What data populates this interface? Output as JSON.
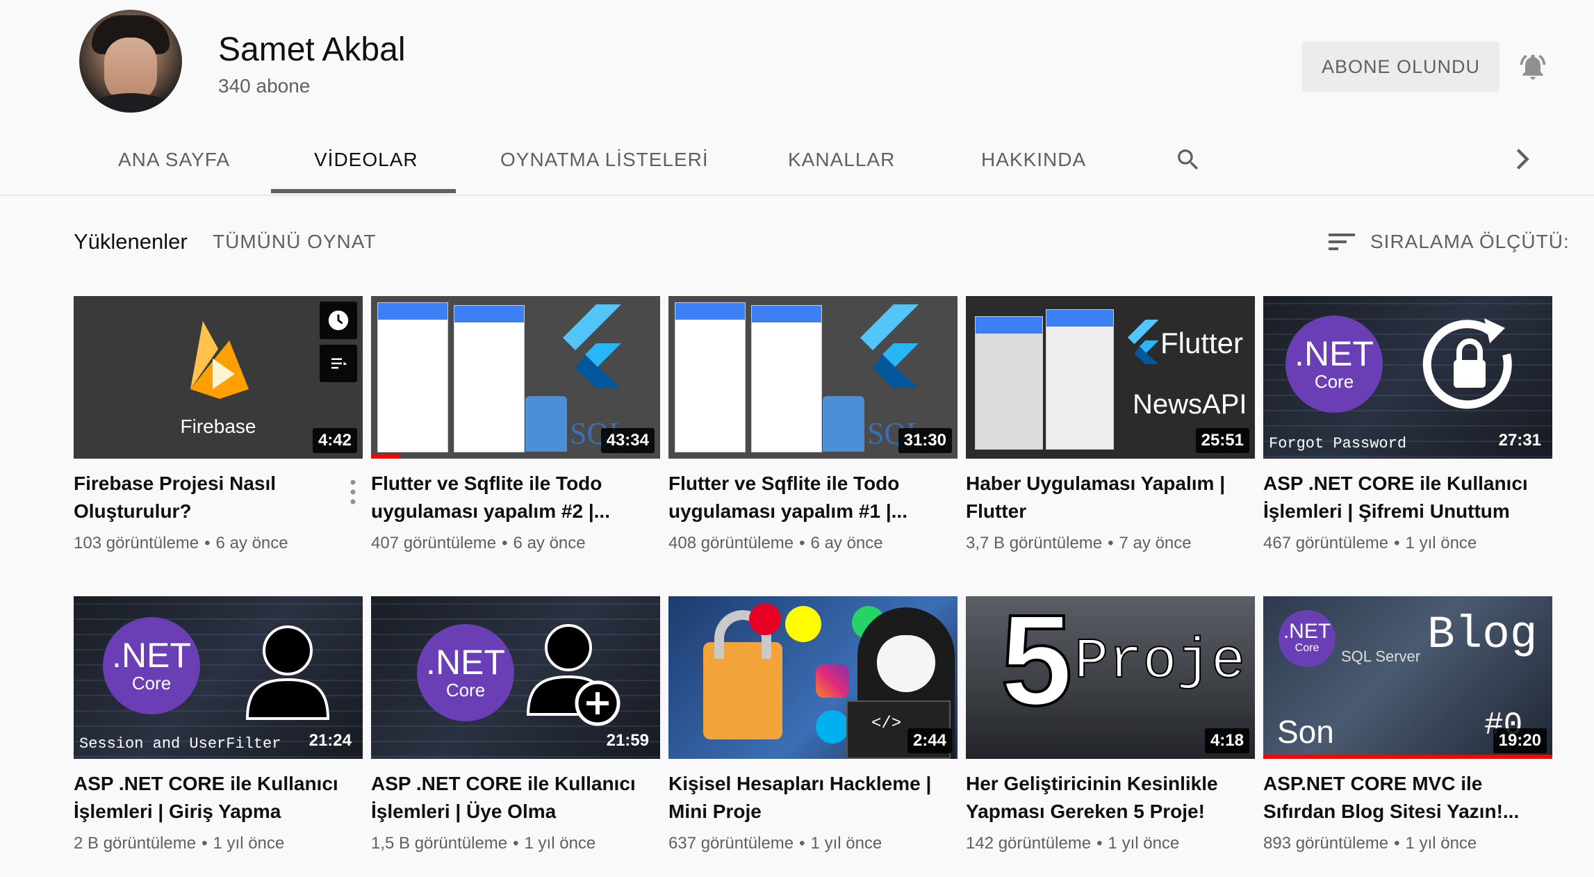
{
  "channel": {
    "name": "Samet Akbal",
    "subscribers": "340 abone",
    "subscribe_label": "ABONE OLUNDU"
  },
  "tabs": [
    {
      "label": "ANA SAYFA"
    },
    {
      "label": "VİDEOLAR"
    },
    {
      "label": "OYNATMA LİSTELERİ"
    },
    {
      "label": "KANALLAR"
    },
    {
      "label": "HAKKINDA"
    }
  ],
  "shelf": {
    "title": "Yüklenenler",
    "play_all": "TÜMÜNÜ OYNAT",
    "sort_label": "SIRALAMA ÖLÇÜTÜ:"
  },
  "videos": [
    {
      "title": "Firebase Projesi Nasıl Oluşturulur?",
      "views": "103 görüntüleme",
      "age": "6 ay önce",
      "duration": "4:42",
      "thumb_text": "Firebase"
    },
    {
      "title": "Flutter ve Sqflite ile Todo uygulaması yapalım #2 |...",
      "views": "407 görüntüleme",
      "age": "6 ay önce",
      "duration": "43:34",
      "watched": 0.1,
      "thumb_text": "SQL"
    },
    {
      "title": "Flutter ve Sqflite ile Todo uygulaması yapalım #1 |...",
      "views": "408 görüntüleme",
      "age": "6 ay önce",
      "duration": "31:30",
      "thumb_text": "SQL"
    },
    {
      "title": "Haber Uygulaması Yapalım | Flutter",
      "views": "3,7 B görüntüleme",
      "age": "7 ay önce",
      "duration": "25:51",
      "thumb_text": "Flutter",
      "thumb_text2": "NewsAPI"
    },
    {
      "title": "ASP .NET CORE ile Kullanıcı İşlemleri | Şifremi Unuttum",
      "views": "467 görüntüleme",
      "age": "1 yıl önce",
      "duration": "27:31",
      "thumb_text": "Forgot Password"
    },
    {
      "title": "ASP .NET CORE ile Kullanıcı İşlemleri | Giriş Yapma",
      "views": "2 B görüntüleme",
      "age": "1 yıl önce",
      "duration": "21:24",
      "thumb_text": "Session and UserFilter"
    },
    {
      "title": "ASP .NET CORE ile Kullanıcı İşlemleri | Üye Olma",
      "views": "1,5 B görüntüleme",
      "age": "1 yıl önce",
      "duration": "21:59"
    },
    {
      "title": "Kişisel Hesapları Hackleme | Mini Proje",
      "views": "637 görüntüleme",
      "age": "1 yıl önce",
      "duration": "2:44",
      "thumb_text": "</>"
    },
    {
      "title": "Her Geliştiricinin Kesinlikle Yapması Gereken 5 Proje!",
      "views": "142 görüntüleme",
      "age": "1 yıl önce",
      "duration": "4:18",
      "thumb_text": "5",
      "thumb_text2": "Proje"
    },
    {
      "title": "ASP.NET CORE MVC ile Sıfırdan Blog Sitesi Yazın!...",
      "views": "893 görüntüleme",
      "age": "1 yıl önce",
      "duration": "19:20",
      "watched": 1.0,
      "thumb_text": "Blog",
      "thumb_text2": "Son",
      "thumb_text3": "#0",
      "thumb_text4": "SQL Server"
    }
  ],
  "net_logo": {
    "big": ".NET",
    "small": "Core"
  },
  "colors": {
    "accent_red": "#ff0000",
    "net_purple": "#6a3fb5",
    "flutter_blue": "#42a5f5"
  }
}
